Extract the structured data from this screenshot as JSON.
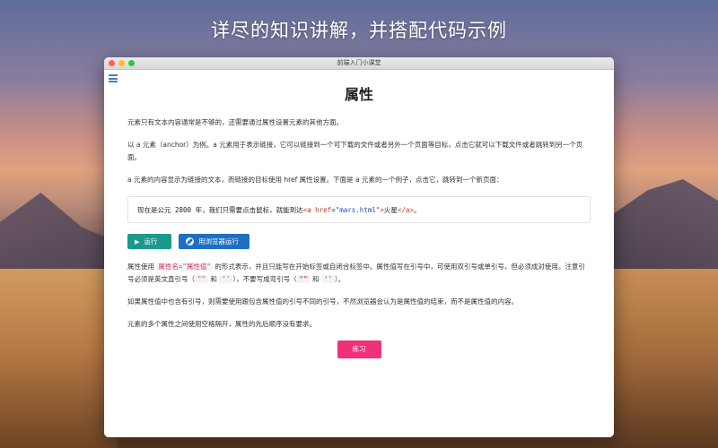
{
  "hero_title": "详尽的知识讲解，并搭配代码示例",
  "window": {
    "title": "前端入门小课堂"
  },
  "page": {
    "title": "属性",
    "p1": "元素只有文本内容通常是不够的，还需要通过属性设置元素的其他方面。",
    "p2": "以 a 元素（anchor）为例。a 元素用于表示链接，它可以链接到一个可下载的文件或者另外一个页面等目标，点击它就可以下载文件或者跳转到另一个页面。",
    "p3": "a 元素的内容显示为链接的文本，而链接的目标使用 href 属性设置。下面是 a 元素的一个例子，点击它，跳转到一个新页面：",
    "code": {
      "prefix": "现在是公元 2800 年，我们只需要点击鼠标，就能到达",
      "open_tag": "<a",
      "attr_name": "href",
      "eq": "=",
      "attr_value": "\"mars.html\"",
      "gt": ">",
      "link_text": "火星",
      "close_tag": "</a>",
      "suffix": "。"
    },
    "buttons": {
      "run": "运行",
      "browser": "用浏览器运行"
    },
    "p4": {
      "a": "属性使用 ",
      "code": "属性名=\"属性值\"",
      "b": " 的形式表示，并且只能写在开始标签或自闭合标签中。属性值写在引号中，可使用双引号或单引号，但必须成对使用。注意引号必须是英文直引号（",
      "q1": "\"\"",
      "c": " 和 ",
      "q2": "''",
      "d": "），不要写成弯引号（",
      "q3": "“”",
      "e": " 和 ",
      "q4": "‘’",
      "f": "）。"
    },
    "p5": "如果属性值中也含有引号，则需要使用跟包含属性值的引号不同的引号，不然浏览器会认为是属性值的结束，而不是属性值的内容。",
    "p6": "元素的多个属性之间使用空格隔开，属性的先后顺序没有要求。",
    "practice": "练习"
  }
}
